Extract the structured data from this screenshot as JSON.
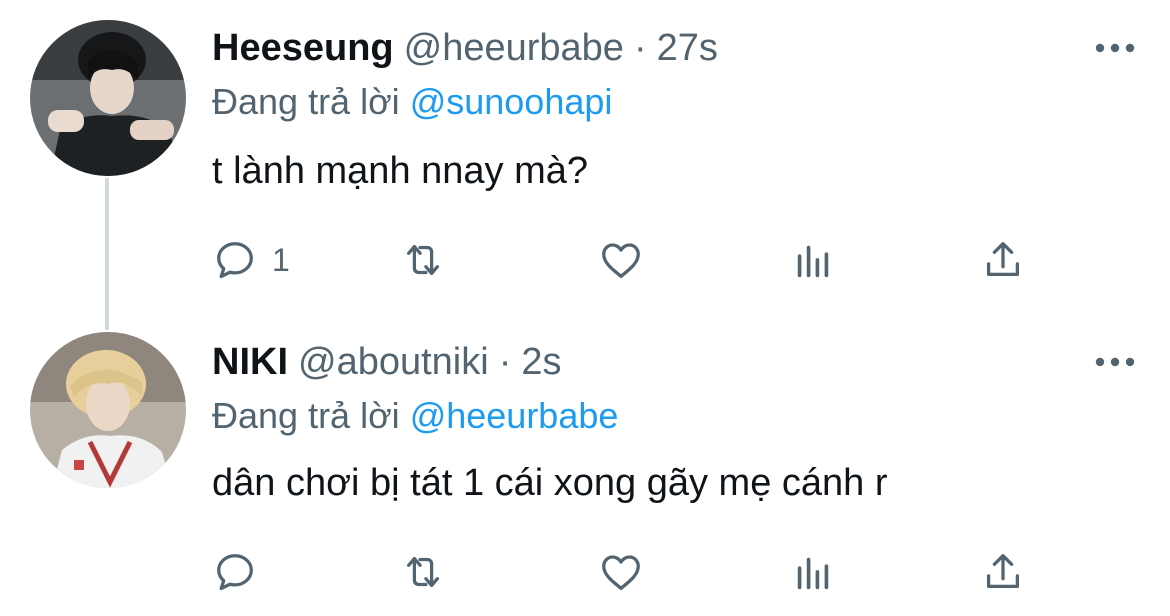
{
  "tweets": [
    {
      "display_name": "Heeseung",
      "handle": "@heeurbabe",
      "separator": "·",
      "time": "27s",
      "replying_prefix": "Đang trả lời ",
      "replying_to": "@sunoohapi",
      "text": "t lành mạnh nnay mà?",
      "reply_count": "1",
      "avatar_icon": "profile-photo-dark-hair"
    },
    {
      "display_name": "NIKI",
      "handle": "@aboutniki",
      "separator": "·",
      "time": "2s",
      "replying_prefix": "Đang trả lời ",
      "replying_to": "@heeurbabe",
      "text": "dân chơi bị tát 1 cái xong gãy mẹ cánh r",
      "reply_count": "",
      "avatar_icon": "profile-photo-blonde-hair"
    }
  ],
  "icons": {
    "reply": "reply-icon",
    "retweet": "retweet-icon",
    "like": "like-icon",
    "views": "views-icon",
    "share": "share-icon",
    "more": "more-icon"
  },
  "colors": {
    "text": "#0f1419",
    "secondary": "#536471",
    "accent": "#1d9bf0",
    "thread_line": "#cfd9de"
  }
}
